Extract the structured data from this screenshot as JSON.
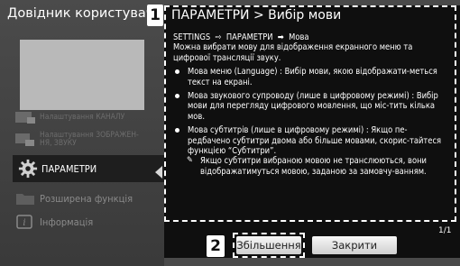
{
  "guide": {
    "title": "Довідник користувача"
  },
  "menu": {
    "items": [
      {
        "label": "Налаштування КАНАЛУ",
        "icon": "channel-settings-icon",
        "state": "dim"
      },
      {
        "label": "Налаштування ЗОБРАЖЕН-\nНЯ, ЗВУКУ",
        "icon": "picture-sound-icon",
        "state": "dim"
      },
      {
        "label": "ПАРАМЕТРИ",
        "icon": "gear-icon",
        "state": "selected"
      },
      {
        "label": "Розширена функція",
        "icon": "folder-icon",
        "state": "normal"
      },
      {
        "label": "Інформація",
        "icon": "info-icon",
        "state": "normal"
      }
    ]
  },
  "badges": {
    "title_badge": "1",
    "button_badge": "2"
  },
  "popup": {
    "title": "ПАРАМЕТРИ > Вибір мови",
    "path_settings": "SETTINGS",
    "path_params": "ПАРАМЕТРИ",
    "path_lang": "Мова",
    "intro": "Можна вибрати мову для відображення екранного меню та цифрової трансляції звуку.",
    "bullets": [
      "Мова меню (Language) : Вибір мови, якою відображати-меться текст на екрані.",
      "Мова звукового супроводу (лише в цифровому режимі) : Вибір мови для перегляду цифрового мовлення, що міс-тить кілька мов.",
      "Мова субтитрів (лише в цифровому режимі) : Якщо пе-редбачено субтитри двома або більше мовами, скорис-тайтеся функцією “Субтитри”."
    ],
    "note": "Якщо субтитри вибраною мовою не транслюються, вони відображатимуться мовою, заданою за замовчу-ванням.",
    "page_indicator": "1/1"
  },
  "buttons": {
    "zoom_label": "Збільшення",
    "close_label": "Закрити"
  },
  "colors": {
    "background": "#4a4a4a",
    "popup_bg": "#0f0f0f",
    "selected_bg": "#1e1e1e",
    "text": "#ffffff"
  }
}
